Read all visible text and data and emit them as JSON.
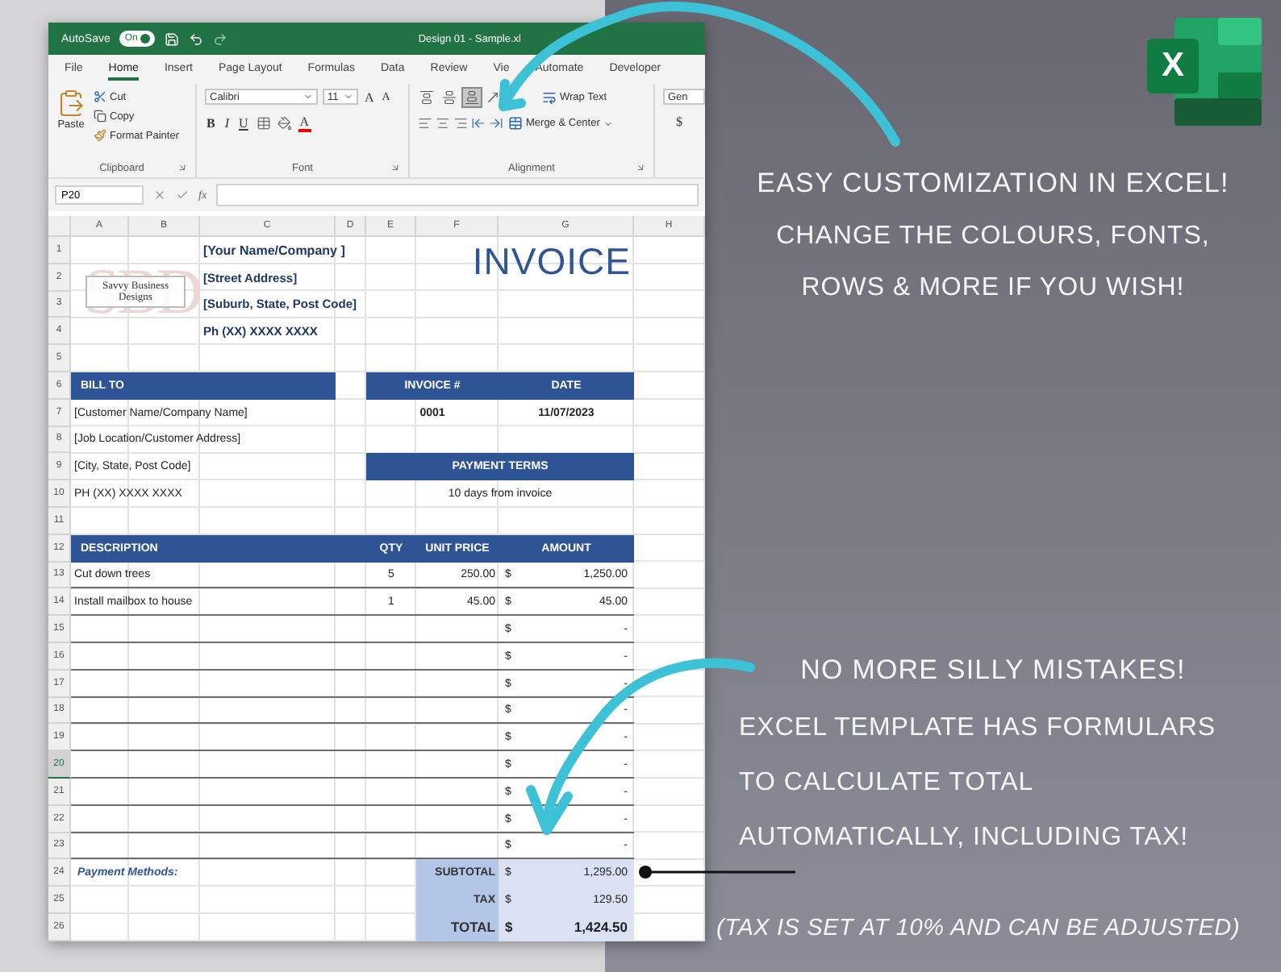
{
  "title_bar": {
    "autosave": {
      "label": "AutoSave",
      "on": true,
      "state_text": "On"
    },
    "title": "Design 01 - Sample.xl"
  },
  "menu_tabs": [
    {
      "label": "File",
      "selected": false
    },
    {
      "label": "Home",
      "selected": true
    },
    {
      "label": "Insert",
      "selected": false
    },
    {
      "label": "Page Layout",
      "selected": false
    },
    {
      "label": "Formulas",
      "selected": false
    },
    {
      "label": "Data",
      "selected": false
    },
    {
      "label": "Review",
      "selected": false
    },
    {
      "label": "Vie",
      "selected": false
    },
    {
      "label": "Automate",
      "selected": false
    },
    {
      "label": "Developer",
      "selected": false
    }
  ],
  "ribbon": {
    "groups": [
      {
        "kind": "clipboard",
        "label": "Clipboard",
        "paste": "Paste",
        "cut": "Cut",
        "copy": "Copy",
        "format_painter": "Format Painter"
      },
      {
        "kind": "font",
        "label": "Font",
        "font_name": "Calibri",
        "font_size": "11",
        "grow": "A",
        "shrink": "A",
        "bold": "B",
        "italic": "I",
        "underline": "U",
        "font_color": "A"
      },
      {
        "kind": "alignment",
        "label": "Alignment",
        "vertical": [
          {
            "kind": "top",
            "selected": false
          },
          {
            "kind": "middle",
            "selected": false
          },
          {
            "kind": "bottom",
            "selected": true
          }
        ],
        "wrap_text": "Wrap Text",
        "merge": "Merge & Center"
      },
      {
        "kind": "number",
        "format": "Gen",
        "currency": "$"
      }
    ]
  },
  "formula_bar": {
    "name_box": "P20",
    "function_label": "fx"
  },
  "sheet": {
    "columns": [
      "A",
      "B",
      "C",
      "D",
      "E",
      "F",
      "G",
      "H"
    ],
    "row_headers": [
      {
        "label": "1",
        "selected": false
      },
      {
        "label": "2",
        "selected": false
      },
      {
        "label": "3",
        "selected": false
      },
      {
        "label": "4",
        "selected": false
      },
      {
        "label": "5",
        "selected": false
      },
      {
        "label": "6",
        "selected": false
      },
      {
        "label": "7",
        "selected": false
      },
      {
        "label": "8",
        "selected": false
      },
      {
        "label": "9",
        "selected": false
      },
      {
        "label": "10",
        "selected": false
      },
      {
        "label": "11",
        "selected": false
      },
      {
        "label": "12",
        "selected": false
      },
      {
        "label": "13",
        "selected": false
      },
      {
        "label": "14",
        "selected": false
      },
      {
        "label": "15",
        "selected": false
      },
      {
        "label": "16",
        "selected": false
      },
      {
        "label": "17",
        "selected": false
      },
      {
        "label": "18",
        "selected": false
      },
      {
        "label": "19",
        "selected": false
      },
      {
        "label": "20",
        "selected": true
      },
      {
        "label": "21",
        "selected": false
      },
      {
        "label": "22",
        "selected": false
      },
      {
        "label": "23",
        "selected": false
      },
      {
        "label": "24",
        "selected": false
      },
      {
        "label": "25",
        "selected": false
      },
      {
        "label": "26",
        "selected": false
      }
    ],
    "logo": {
      "monogram": "SBD",
      "name": "Savvy Business Designs"
    },
    "company_lines": [
      "[Your Name/Company ]",
      "[Street Address]",
      "[Suburb, State, Post Code]",
      "Ph (XX) XXXX XXXX"
    ],
    "title": "INVOICE",
    "bill_to": {
      "header": "BILL TO",
      "lines": [
        "[Customer Name/Company Name]",
        "[Job Location/Customer Address]",
        "[City, State, Post Code]",
        "PH (XX) XXXX XXXX"
      ]
    },
    "invoice_info": {
      "number_header": "INVOICE #",
      "date_header": "DATE",
      "number": "0001",
      "date": "11/07/2023"
    },
    "payment_terms": {
      "header": "PAYMENT TERMS",
      "value": "10 days from invoice"
    },
    "items": {
      "columns": [
        "DESCRIPTION",
        "QTY",
        "UNIT PRICE",
        "AMOUNT"
      ],
      "rows": [
        {
          "description": "Cut down trees",
          "qty": "5",
          "unit_price": "250.00",
          "currency": "$",
          "amount": "1,250.00"
        },
        {
          "description": "Install mailbox to house",
          "qty": "1",
          "unit_price": "45.00",
          "currency": "$",
          "amount": "45.00"
        },
        {
          "currency": "$",
          "amount": "-"
        },
        {
          "currency": "$",
          "amount": "-"
        },
        {
          "currency": "$",
          "amount": "-"
        },
        {
          "currency": "$",
          "amount": "-"
        },
        {
          "currency": "$",
          "amount": "-"
        },
        {
          "currency": "$",
          "amount": "-"
        },
        {
          "currency": "$",
          "amount": "-"
        },
        {
          "currency": "$",
          "amount": "-"
        },
        {
          "currency": "$",
          "amount": "-"
        }
      ]
    },
    "payment_methods": "Payment Methods:",
    "totals": [
      {
        "kind": "line",
        "label": "SUBTOTAL",
        "currency": "$",
        "amount": "1,295.00"
      },
      {
        "kind": "line",
        "label": "TAX",
        "currency": "$",
        "amount": "129.50"
      },
      {
        "kind": "grand",
        "label": "TOTAL",
        "currency": "$",
        "amount": "1,424.50"
      }
    ]
  },
  "logo": {
    "letter": "X"
  },
  "promo": {
    "top": {
      "heading": "EASY CUSTOMIZATION IN EXCEL!",
      "lines": [
        "CHANGE THE COLOURS, FONTS,",
        "ROWS & MORE IF YOU WISH!"
      ]
    },
    "bottom": {
      "heading": "NO MORE SILLY MISTAKES!",
      "lines": [
        "EXCEL TEMPLATE HAS FORMULARS",
        "TO CALCULATE TOTAL",
        "AUTOMATICALLY, INCLUDING TAX!"
      ],
      "note": "(TAX IS SET AT 10% AND CAN BE ADJUSTED)"
    }
  }
}
